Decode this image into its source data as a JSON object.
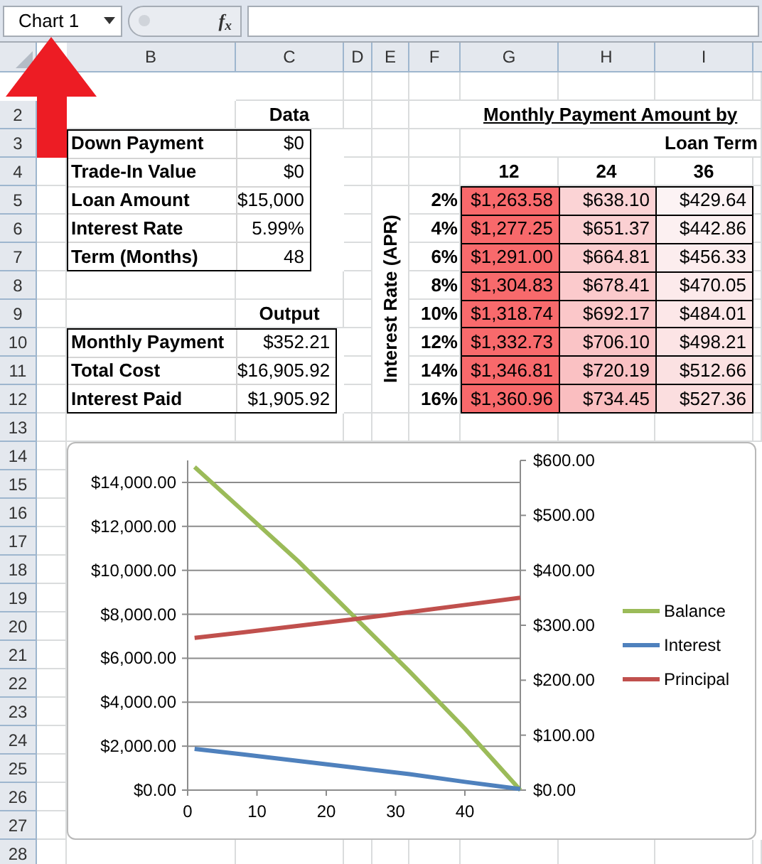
{
  "formula_bar": {
    "name_box": "Chart 1",
    "function_button": "f$_{x}$"
  },
  "columns": [
    "B",
    "C",
    "D",
    "E",
    "F",
    "G",
    "H",
    "I"
  ],
  "rows": [
    "2",
    "3",
    "4",
    "5",
    "6",
    "7",
    "8",
    "9",
    "10",
    "11",
    "12",
    "13",
    "14",
    "15",
    "16",
    "17",
    "18",
    "19",
    "20",
    "21",
    "22",
    "23",
    "24",
    "25",
    "26",
    "27",
    "28"
  ],
  "inputs": {
    "title": "Data",
    "rows": [
      {
        "label": "Down Payment",
        "value": "$0"
      },
      {
        "label": "Trade-In Value",
        "value": "$0"
      },
      {
        "label": "Loan Amount",
        "value": "$15,000"
      },
      {
        "label": "Interest Rate",
        "value": "5.99%"
      },
      {
        "label": "Term (Months)",
        "value": "48"
      }
    ]
  },
  "outputs": {
    "title": "Output",
    "rows": [
      {
        "label": "Monthly Payment",
        "value": "$352.21"
      },
      {
        "label": "Total Cost",
        "value": "$16,905.92"
      },
      {
        "label": "Interest Paid",
        "value": "$1,905.92"
      }
    ]
  },
  "payment_table": {
    "title": "Monthly Payment Amount by",
    "subtitle": "Loan Term",
    "row_axis_label": "Interest Rate (APR)",
    "terms": [
      "12",
      "24",
      "36"
    ],
    "rows": [
      {
        "rate": "2%",
        "cells": [
          {
            "value": "$1,263.58",
            "color": "#f8696b"
          },
          {
            "value": "$638.10",
            "color": "#fbd3d5"
          },
          {
            "value": "$429.64",
            "color": "#fcf3f4"
          }
        ]
      },
      {
        "rate": "4%",
        "cells": [
          {
            "value": "$1,277.25",
            "color": "#f8696b"
          },
          {
            "value": "$651.37",
            "color": "#fbd0d2"
          },
          {
            "value": "$442.86",
            "color": "#fcf0f1"
          }
        ]
      },
      {
        "rate": "6%",
        "cells": [
          {
            "value": "$1,291.00",
            "color": "#f86a6c"
          },
          {
            "value": "$664.81",
            "color": "#fbcdcf"
          },
          {
            "value": "$456.33",
            "color": "#fcedee"
          }
        ]
      },
      {
        "rate": "8%",
        "cells": [
          {
            "value": "$1,304.83",
            "color": "#f86a6c"
          },
          {
            "value": "$678.41",
            "color": "#fbcacc"
          },
          {
            "value": "$470.05",
            "color": "#fceaeb"
          }
        ]
      },
      {
        "rate": "10%",
        "cells": [
          {
            "value": "$1,318.74",
            "color": "#f86a6c"
          },
          {
            "value": "$692.17",
            "color": "#fbc7c9"
          },
          {
            "value": "$484.01",
            "color": "#fce7e8"
          }
        ]
      },
      {
        "rate": "12%",
        "cells": [
          {
            "value": "$1,332.73",
            "color": "#f86a6c"
          },
          {
            "value": "$706.10",
            "color": "#fac4c6"
          },
          {
            "value": "$498.21",
            "color": "#fce4e5"
          }
        ]
      },
      {
        "rate": "14%",
        "cells": [
          {
            "value": "$1,346.81",
            "color": "#f8696b"
          },
          {
            "value": "$720.19",
            "color": "#fac1c3"
          },
          {
            "value": "$512.66",
            "color": "#fbe1e2"
          }
        ]
      },
      {
        "rate": "16%",
        "cells": [
          {
            "value": "$1,360.96",
            "color": "#f8696b"
          },
          {
            "value": "$734.45",
            "color": "#fabec0"
          },
          {
            "value": "$527.36",
            "color": "#fbdedf"
          }
        ]
      }
    ]
  },
  "chart": {
    "chart_data": {
      "type": "line",
      "grid": true,
      "legend": true,
      "x": [
        1,
        8,
        16,
        24,
        32,
        40,
        48
      ],
      "xlim": [
        0,
        48
      ],
      "ylim": [
        0,
        15000
      ],
      "y2lim": [
        0,
        600
      ],
      "xticks": [
        0,
        10,
        20,
        30,
        40
      ],
      "yticks": [
        {
          "value": 0,
          "label": "$0.00"
        },
        {
          "value": 2000,
          "label": "$2,000.00"
        },
        {
          "value": 4000,
          "label": "$4,000.00"
        },
        {
          "value": 6000,
          "label": "$6,000.00"
        },
        {
          "value": 8000,
          "label": "$8,000.00"
        },
        {
          "value": 10000,
          "label": "$10,000.00"
        },
        {
          "value": 12000,
          "label": "$12,000.00"
        },
        {
          "value": 14000,
          "label": "$14,000.00"
        }
      ],
      "y2ticks": [
        {
          "value": 0,
          "label": "$0.00"
        },
        {
          "value": 100,
          "label": "$100.00"
        },
        {
          "value": 200,
          "label": "$200.00"
        },
        {
          "value": 300,
          "label": "$300.00"
        },
        {
          "value": 400,
          "label": "$400.00"
        },
        {
          "value": 500,
          "label": "$500.00"
        },
        {
          "value": 600,
          "label": "$600.00"
        }
      ],
      "series": [
        {
          "name": "Balance",
          "color": "#9bbb59",
          "axis": "y",
          "values": [
            14700,
            12700,
            10400,
            7900,
            5400,
            2800,
            0
          ]
        },
        {
          "name": "Interest",
          "color": "#4f81bd",
          "axis": "y2",
          "values": [
            75,
            65,
            53,
            41,
            29,
            15,
            2
          ]
        },
        {
          "name": "Principal",
          "color": "#c0504d",
          "axis": "y2",
          "values": [
            277,
            287,
            299,
            311,
            324,
            337,
            350
          ]
        }
      ]
    }
  }
}
